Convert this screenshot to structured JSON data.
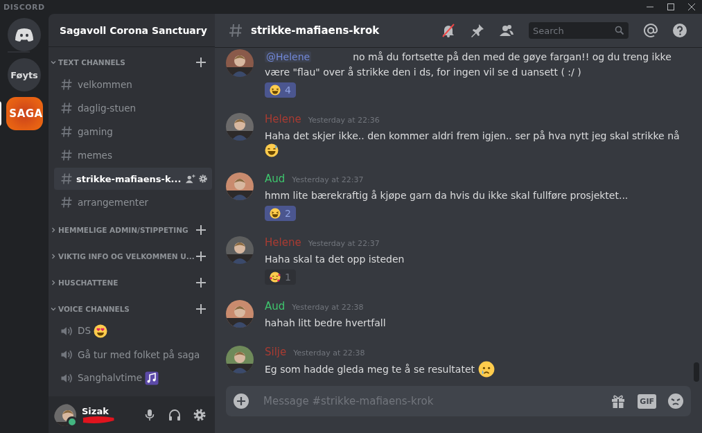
{
  "title_bar": {
    "logo": "DISCORD"
  },
  "servers": [
    {
      "kind": "home",
      "selected": false
    },
    {
      "kind": "text",
      "label": "Føyts",
      "selected": false
    },
    {
      "kind": "logo",
      "label": "SAGA",
      "selected": true
    }
  ],
  "server_name": "Sagavoll Corona Sanctuary",
  "categories": [
    {
      "name": "TEXT CHANNELS",
      "expanded": true,
      "channels": [
        {
          "kind": "text",
          "name": "velkommen",
          "selected": false
        },
        {
          "kind": "text",
          "name": "daglig-stuen",
          "selected": false
        },
        {
          "kind": "text",
          "name": "gaming",
          "selected": false
        },
        {
          "kind": "text",
          "name": "memes",
          "selected": false
        },
        {
          "kind": "text",
          "name": "strikke-mafiaens-k...",
          "selected": true
        },
        {
          "kind": "text",
          "name": "arrangementer",
          "selected": false
        }
      ]
    },
    {
      "name": "HEMMELIGE ADMIN/STIPPETING",
      "expanded": false
    },
    {
      "name": "VIKTIG INFO OG VELKOMMEN U...",
      "expanded": false
    },
    {
      "name": "HUSCHATTENE",
      "expanded": false
    },
    {
      "name": "VOICE CHANNELS",
      "expanded": true,
      "channels": [
        {
          "kind": "voice",
          "name": "DS",
          "selected": false
        },
        {
          "kind": "voice",
          "name": "Gå tur med folket på saga",
          "selected": false
        },
        {
          "kind": "voice",
          "name": "Sanghalvtime",
          "selected": false
        }
      ]
    }
  ],
  "user": {
    "name": "Sizak",
    "online": true
  },
  "header": {
    "channel": "strikke-mafiaens-krok",
    "search_placeholder": "Search"
  },
  "messages": [
    {
      "mention": "@Helene",
      "text": "no må du fortsette på den med de gøye fargan!! og du treng ikke være \"flau\" over å strikke den i ds, for ingen vil se d uansett ( :/ )",
      "reactions": [
        {
          "count": "4",
          "selected": true
        }
      ]
    },
    {
      "author": "Helene",
      "color": "#a93b32",
      "time": "Yesterday at 22:36",
      "text": "Haha det skjer ikke.. den kommer aldri frem igjen.. ser på hva nytt jeg skal strikke nå"
    },
    {
      "author": "Aud",
      "color": "#3ec46d",
      "time": "Yesterday at 22:37",
      "text": "hmm lite bærekraftig å kjøpe garn da hvis du ikke skal fullføre prosjektet...",
      "reactions": [
        {
          "count": "2",
          "selected": true
        }
      ]
    },
    {
      "author": "Helene",
      "color": "#a93b32",
      "time": "Yesterday at 22:37",
      "text": "Haha skal ta det opp isteden",
      "reactions": [
        {
          "count": "1",
          "selected": false
        }
      ]
    },
    {
      "author": "Aud",
      "color": "#3ec46d",
      "time": "Yesterday at 22:38",
      "text": "hahah litt bedre hvertfall"
    },
    {
      "author": "Silje",
      "color": "#a93b32",
      "time": "Yesterday at 22:38",
      "text": "Eg som hadde gleda meg te å se resultatet"
    }
  ],
  "composer": {
    "placeholder": "Message #strikke-mafiaens-krok",
    "gif": "GIF"
  }
}
